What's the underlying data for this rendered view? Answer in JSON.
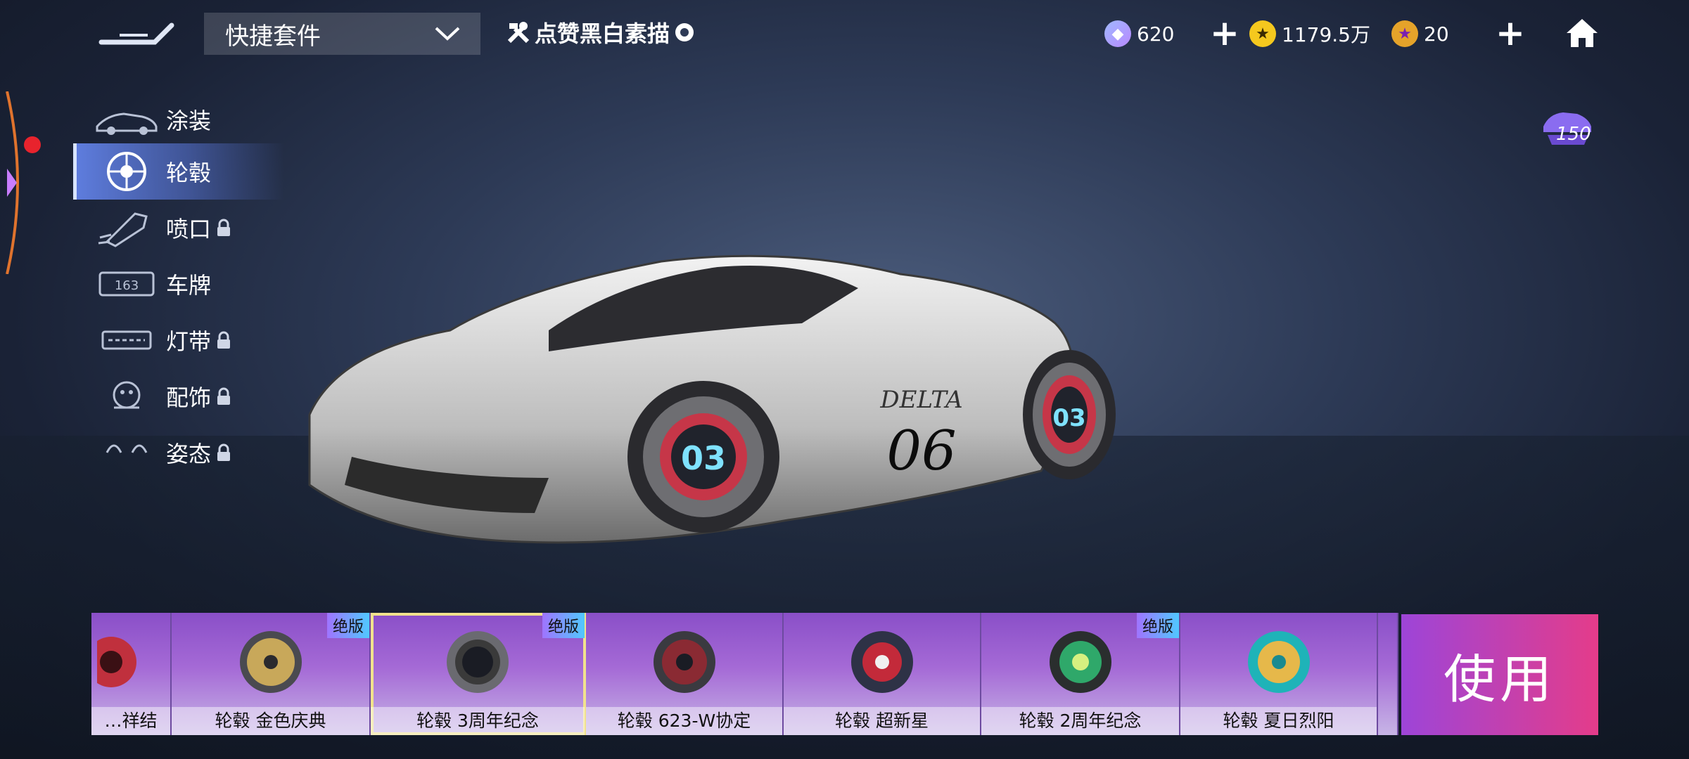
{
  "topbar": {
    "kit_label": "快捷套件",
    "likes_label": "点赞黑白素描",
    "gems": "620",
    "coins": "1179.5万",
    "stars": "20"
  },
  "garage_count": "150",
  "menu": [
    {
      "label": "涂装",
      "locked": false,
      "icon": "paint-car-icon"
    },
    {
      "label": "轮毂",
      "locked": false,
      "icon": "wheel-icon"
    },
    {
      "label": "喷口",
      "locked": true,
      "icon": "exhaust-icon"
    },
    {
      "label": "车牌",
      "locked": false,
      "icon": "license-plate-icon"
    },
    {
      "label": "灯带",
      "locked": true,
      "icon": "light-strip-icon"
    },
    {
      "label": "配饰",
      "locked": true,
      "icon": "accessory-icon"
    },
    {
      "label": "姿态",
      "locked": true,
      "icon": "pose-icon"
    }
  ],
  "car_text": {
    "number": "06",
    "wheel_number": "03",
    "logo": "DELTA"
  },
  "items": [
    {
      "label": "…祥结",
      "badge": "",
      "color": "#c0303d"
    },
    {
      "label": "轮毂 金色庆典",
      "badge": "绝版",
      "color": "#c8a85a"
    },
    {
      "label": "轮毂 3周年纪念",
      "badge": "绝版",
      "color": "#3a3a3a"
    },
    {
      "label": "轮毂 623-W协定",
      "badge": "",
      "color": "#8a2a33"
    },
    {
      "label": "轮毂 超新星",
      "badge": "",
      "color": "#c32a3a"
    },
    {
      "label": "轮毂 2周年纪念",
      "badge": "绝版",
      "color": "#2fa86a"
    },
    {
      "label": "轮毂 夏日烈阳",
      "badge": "",
      "color": "#1fb3b8"
    }
  ],
  "use_button": "使用",
  "colors": {
    "accent": "#e43c8a",
    "selected_border": "#f1e28d"
  }
}
